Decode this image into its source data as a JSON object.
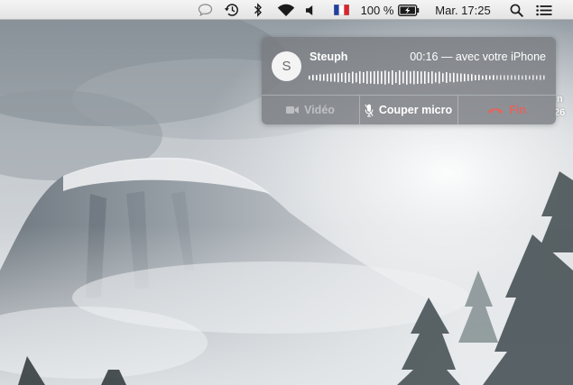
{
  "menubar": {
    "battery_percent": "100 %",
    "clock": "Mar. 17:25",
    "icons": [
      "message-bubble-icon",
      "time-machine-icon",
      "bluetooth-icon",
      "wifi-icon",
      "volume-icon",
      "french-flag-icon",
      "battery-charging-icon",
      "spotlight-search-icon",
      "notification-center-icon"
    ]
  },
  "call": {
    "avatar_initial": "S",
    "caller_name": "Steuph",
    "duration": "00:16",
    "status": "— avec votre iPhone",
    "buttons": {
      "video": "Vidéo",
      "mute": "Couper micro",
      "end": "Fin"
    },
    "end_color": "#e2655f"
  },
  "background": {
    "peek_line1": "n",
    "peek_line2": "26"
  }
}
